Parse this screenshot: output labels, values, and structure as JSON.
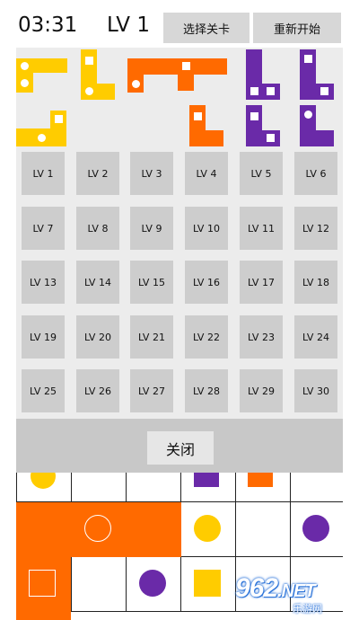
{
  "header": {
    "time": "03:31",
    "level": "LV 1",
    "select_level_label": "选择关卡",
    "restart_label": "重新开始"
  },
  "level_select": {
    "levels": [
      "LV 1",
      "LV 2",
      "LV 3",
      "LV 4",
      "LV 5",
      "LV 6",
      "LV 7",
      "LV 8",
      "LV 9",
      "LV 10",
      "LV 11",
      "LV 12",
      "LV 13",
      "LV 14",
      "LV 15",
      "LV 16",
      "LV 17",
      "LV 18",
      "LV 19",
      "LV 20",
      "LV 21",
      "LV 22",
      "LV 23",
      "LV 24",
      "LV 25",
      "LV 26",
      "LV 27",
      "LV 28",
      "LV 29",
      "LV 30"
    ],
    "close_label": "关闭"
  },
  "colors": {
    "yellow": "#ffcc00",
    "orange": "#ff6a00",
    "purple": "#6a2aa8",
    "button_gray": "#cdcdcd",
    "panel_gray": "#ececec"
  },
  "watermark": {
    "logo": "962",
    "logo_suffix": ".NET",
    "subtitle": "乐游网"
  }
}
